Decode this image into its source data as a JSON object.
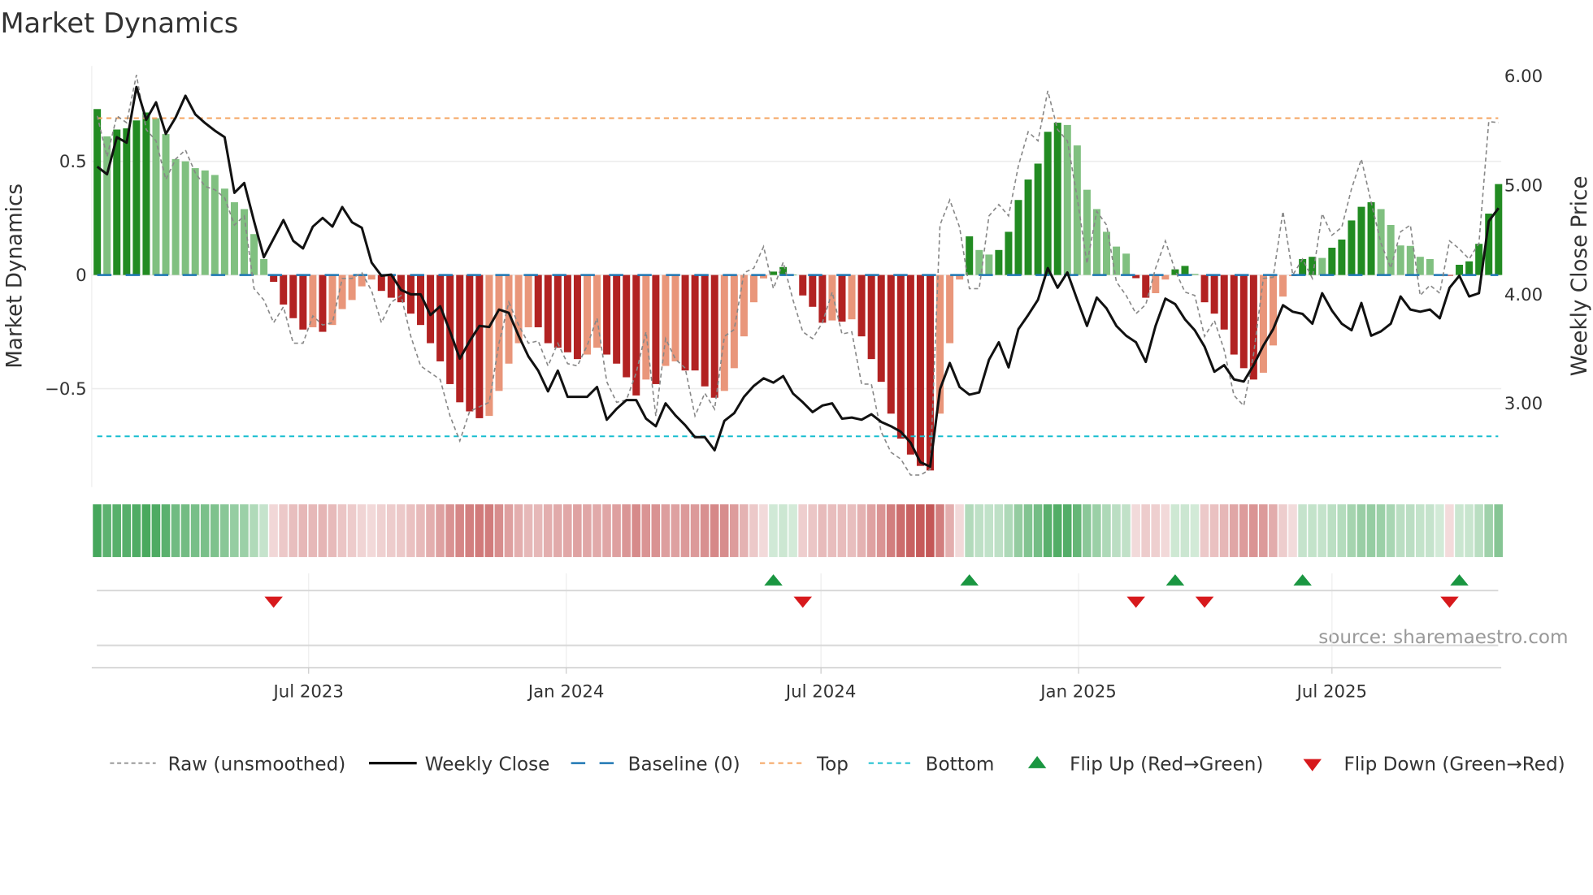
{
  "chart_data": {
    "type": "bar",
    "title": "Market Dynamics",
    "ylabel": "Market Dynamics",
    "y2label": "Weekly Close Price",
    "ylim": [
      -0.93,
      0.92
    ],
    "y2lim": [
      2.23,
      6.09
    ],
    "yticks": [
      {
        "v": 0.5,
        "label": "0.5"
      },
      {
        "v": 0,
        "label": "0"
      },
      {
        "v": -0.5,
        "label": "−0.5"
      }
    ],
    "y2ticks": [
      {
        "v": 6,
        "label": "6.00"
      },
      {
        "v": 5,
        "label": "5.00"
      },
      {
        "v": 4,
        "label": "4.00"
      },
      {
        "v": 3,
        "label": "3.00"
      }
    ],
    "x_start_date": "2023-01-31",
    "x_frequency": "weekly",
    "xticks": [
      {
        "date": "2023-07-01",
        "label": "Jul 2023"
      },
      {
        "date": "2024-01-01",
        "label": "Jan 2024"
      },
      {
        "date": "2024-07-01",
        "label": "Jul 2024"
      },
      {
        "date": "2025-01-01",
        "label": "Jan 2025"
      },
      {
        "date": "2025-07-01",
        "label": "Jul 2025"
      }
    ],
    "grid": true,
    "top_level": 0.69,
    "bottom_level": -0.71,
    "baseline": 0,
    "dynamics": [
      0.73,
      0.61,
      0.64,
      0.645,
      0.68,
      0.715,
      0.69,
      0.62,
      0.51,
      0.5,
      0.47,
      0.46,
      0.44,
      0.38,
      0.32,
      0.29,
      0.18,
      0.07,
      -0.03,
      -0.13,
      -0.19,
      -0.24,
      -0.23,
      -0.25,
      -0.22,
      -0.15,
      -0.11,
      -0.05,
      -0.02,
      -0.07,
      -0.1,
      -0.12,
      -0.17,
      -0.22,
      -0.3,
      -0.38,
      -0.48,
      -0.56,
      -0.6,
      -0.63,
      -0.62,
      -0.51,
      -0.39,
      -0.3,
      -0.23,
      -0.23,
      -0.3,
      -0.32,
      -0.34,
      -0.37,
      -0.35,
      -0.32,
      -0.35,
      -0.39,
      -0.45,
      -0.53,
      -0.46,
      -0.48,
      -0.4,
      -0.38,
      -0.42,
      -0.42,
      -0.49,
      -0.54,
      -0.51,
      -0.41,
      -0.27,
      -0.12,
      -0.015,
      0.015,
      0.035,
      0.002,
      -0.09,
      -0.14,
      -0.21,
      -0.2,
      -0.205,
      -0.195,
      -0.27,
      -0.37,
      -0.47,
      -0.61,
      -0.72,
      -0.79,
      -0.84,
      -0.86,
      -0.61,
      -0.3,
      -0.02,
      0.17,
      0.11,
      0.09,
      0.11,
      0.19,
      0.33,
      0.42,
      0.49,
      0.63,
      0.67,
      0.66,
      0.57,
      0.375,
      0.29,
      0.19,
      0.125,
      0.094,
      -0.014,
      -0.1,
      -0.08,
      -0.02,
      0.025,
      0.04,
      0.005,
      -0.12,
      -0.17,
      -0.24,
      -0.35,
      -0.41,
      -0.46,
      -0.43,
      -0.31,
      -0.095,
      -0.005,
      0.07,
      0.08,
      0.075,
      0.12,
      0.156,
      0.24,
      0.3,
      0.32,
      0.29,
      0.22,
      0.13,
      0.128,
      0.08,
      0.07,
      0.004,
      -0.003,
      0.045,
      0.06,
      0.137,
      0.27,
      0.4
    ],
    "raw": [
      0.7,
      0.52,
      0.7,
      0.67,
      0.88,
      0.64,
      0.59,
      0.42,
      0.51,
      0.55,
      0.45,
      0.39,
      0.375,
      0.34,
      0.22,
      0.26,
      -0.06,
      -0.11,
      -0.21,
      -0.14,
      -0.3,
      -0.3,
      -0.18,
      -0.22,
      -0.21,
      -0.015,
      -0.015,
      0.01,
      -0.07,
      -0.21,
      -0.12,
      -0.09,
      -0.27,
      -0.4,
      -0.43,
      -0.46,
      -0.62,
      -0.73,
      -0.6,
      -0.58,
      -0.56,
      -0.3,
      -0.12,
      -0.22,
      -0.3,
      -0.29,
      -0.4,
      -0.3,
      -0.39,
      -0.4,
      -0.31,
      -0.19,
      -0.47,
      -0.56,
      -0.55,
      -0.43,
      -0.25,
      -0.62,
      -0.28,
      -0.37,
      -0.41,
      -0.62,
      -0.52,
      -0.59,
      -0.27,
      -0.24,
      0.01,
      0.03,
      0.125,
      -0.06,
      0.056,
      -0.11,
      -0.25,
      -0.28,
      -0.21,
      -0.075,
      -0.26,
      -0.25,
      -0.48,
      -0.48,
      -0.69,
      -0.78,
      -0.81,
      -0.88,
      -0.88,
      -0.855,
      0.22,
      0.33,
      0.21,
      -0.06,
      -0.06,
      0.26,
      0.31,
      0.26,
      0.48,
      0.63,
      0.59,
      0.81,
      0.64,
      0.59,
      0.34,
      0.05,
      0.28,
      0.22,
      -0.03,
      -0.09,
      -0.17,
      -0.13,
      0.03,
      0.15,
      0.02,
      -0.075,
      -0.09,
      -0.27,
      -0.2,
      -0.33,
      -0.53,
      -0.575,
      -0.35,
      -0.015,
      -0.01,
      0.28,
      0,
      0.07,
      -0.015,
      0.27,
      0.175,
      0.21,
      0.38,
      0.51,
      0.32,
      0.14,
      0.03,
      0.19,
      0.22,
      -0.09,
      -0.045,
      -0.08,
      0.15,
      0.115,
      0.07,
      0.14,
      0.675,
      0.67
    ],
    "weekly_close": [
      5.17,
      5.1,
      5.44,
      5.39,
      5.9,
      5.6,
      5.76,
      5.47,
      5.62,
      5.82,
      5.65,
      5.57,
      5.5,
      5.44,
      4.93,
      5.02,
      4.67,
      4.34,
      4.51,
      4.68,
      4.49,
      4.42,
      4.62,
      4.7,
      4.62,
      4.8,
      4.66,
      4.61,
      4.29,
      4.17,
      4.18,
      4.04,
      4.0,
      4.0,
      3.81,
      3.89,
      3.66,
      3.41,
      3.57,
      3.71,
      3.7,
      3.86,
      3.83,
      3.62,
      3.43,
      3.3,
      3.11,
      3.3,
      3.06,
      3.06,
      3.06,
      3.15,
      2.85,
      2.95,
      3.03,
      3.03,
      2.86,
      2.79,
      3.0,
      2.89,
      2.8,
      2.69,
      2.69,
      2.57,
      2.84,
      2.91,
      3.06,
      3.16,
      3.23,
      3.19,
      3.25,
      3.09,
      3.01,
      2.92,
      2.98,
      3.0,
      2.86,
      2.87,
      2.85,
      2.9,
      2.83,
      2.79,
      2.74,
      2.64,
      2.46,
      2.42,
      3.13,
      3.37,
      3.15,
      3.08,
      3.1,
      3.4,
      3.56,
      3.33,
      3.68,
      3.81,
      3.95,
      4.24,
      4.06,
      4.2,
      3.95,
      3.71,
      3.97,
      3.87,
      3.71,
      3.62,
      3.56,
      3.38,
      3.71,
      3.96,
      3.91,
      3.77,
      3.67,
      3.52,
      3.29,
      3.35,
      3.22,
      3.2,
      3.35,
      3.53,
      3.68,
      3.9,
      3.84,
      3.82,
      3.73,
      4.01,
      3.85,
      3.73,
      3.67,
      3.92,
      3.62,
      3.66,
      3.73,
      3.98,
      3.86,
      3.84,
      3.86,
      3.78,
      4.06,
      4.17,
      3.98,
      4.01,
      4.67,
      4.79
    ],
    "flip_up_weeks": [
      69,
      89,
      110,
      123,
      139
    ],
    "flip_down_weeks": [
      18,
      72,
      106,
      113,
      138
    ],
    "legend_position": "bottom",
    "legend": [
      {
        "key": "raw",
        "label": "Raw (unsmoothed)"
      },
      {
        "key": "close",
        "label": "Weekly Close"
      },
      {
        "key": "baseline",
        "label": "Baseline (0)"
      },
      {
        "key": "top",
        "label": "Top"
      },
      {
        "key": "bottom",
        "label": "Bottom"
      },
      {
        "key": "up",
        "label": "Flip Up (Red→Green)"
      },
      {
        "key": "down",
        "label": "Flip Down (Green→Red)"
      }
    ],
    "source": "source: sharemaestro.com"
  },
  "colors": {
    "green_rising": "#228b22",
    "green_falling": "#80c080",
    "red_falling": "#b22222",
    "red_rising": "#e9967a",
    "baseline": "#1f77b4",
    "top": "#f4a460",
    "bottom": "#17becf",
    "raw": "#888888",
    "close": "#111111",
    "flip_up": "#1a9641",
    "flip_down": "#d7191c"
  }
}
